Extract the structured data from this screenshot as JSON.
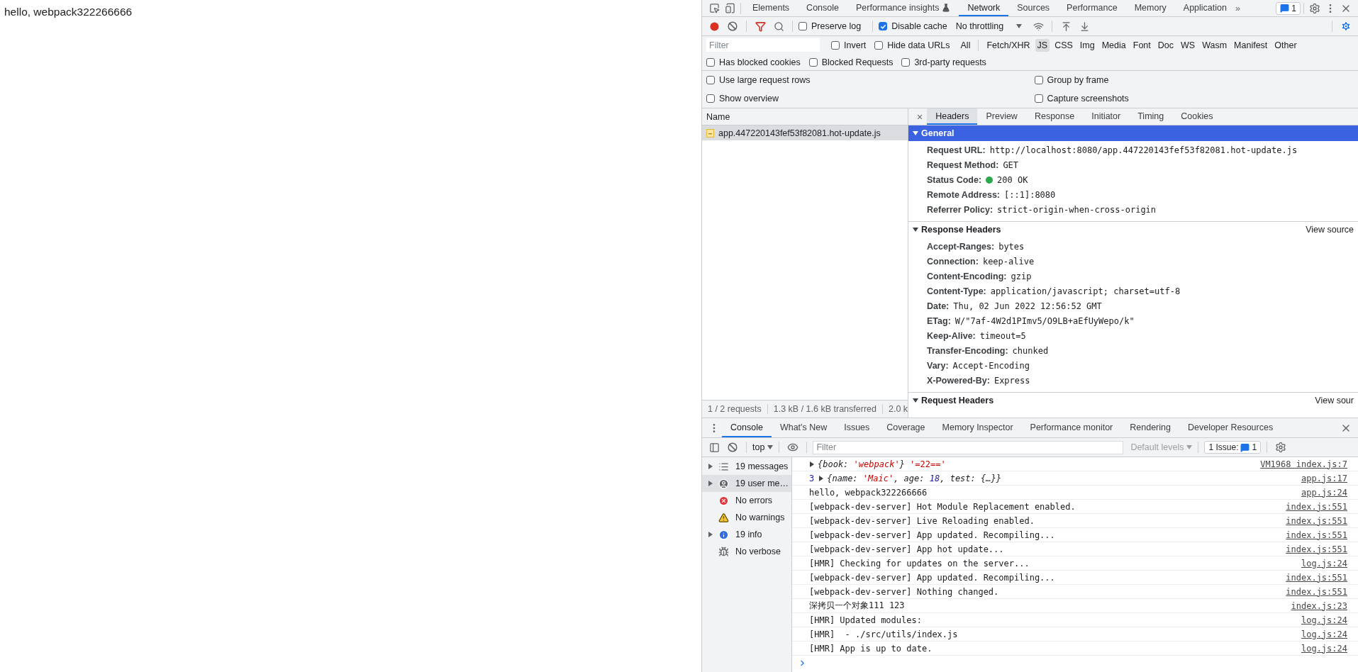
{
  "page": {
    "text": "hello, webpack322266666"
  },
  "main_tabs": [
    {
      "label": "Elements",
      "selected": false,
      "kind": "plain"
    },
    {
      "label": "Console",
      "selected": false,
      "kind": "plain"
    },
    {
      "label": "Performance insights",
      "selected": false,
      "kind": "experimental"
    },
    {
      "label": "Network",
      "selected": true,
      "kind": "plain"
    },
    {
      "label": "Sources",
      "selected": false,
      "kind": "plain"
    },
    {
      "label": "Performance",
      "selected": false,
      "kind": "plain"
    },
    {
      "label": "Memory",
      "selected": false,
      "kind": "plain"
    },
    {
      "label": "Application",
      "selected": false,
      "kind": "plain"
    }
  ],
  "more_tabs": "»",
  "issues_count": "1",
  "network_toolbar": {
    "recording": true,
    "filter_active": true,
    "checks": [
      {
        "label": "Preserve log",
        "checked": false
      },
      {
        "label": "Disable cache",
        "checked": true
      }
    ],
    "throttling": "No throttling"
  },
  "filter_row": {
    "placeholder": "Filter",
    "checks": [
      {
        "label": "Invert",
        "checked": false
      },
      {
        "label": "Hide data URLs",
        "checked": false
      }
    ],
    "types": [
      {
        "label": "All",
        "selected": false
      },
      {
        "label": "Fetch/XHR",
        "selected": false
      },
      {
        "label": "JS",
        "selected": true
      },
      {
        "label": "CSS",
        "selected": false
      },
      {
        "label": "Img",
        "selected": false
      },
      {
        "label": "Media",
        "selected": false
      },
      {
        "label": "Font",
        "selected": false
      },
      {
        "label": "Doc",
        "selected": false
      },
      {
        "label": "WS",
        "selected": false
      },
      {
        "label": "Wasm",
        "selected": false
      },
      {
        "label": "Manifest",
        "selected": false
      },
      {
        "label": "Other",
        "selected": false
      }
    ]
  },
  "blocked_row": [
    {
      "label": "Has blocked cookies",
      "checked": false
    },
    {
      "label": "Blocked Requests",
      "checked": false
    },
    {
      "label": "3rd-party requests",
      "checked": false
    }
  ],
  "settings": {
    "left": [
      {
        "label": "Use large request rows",
        "checked": false
      },
      {
        "label": "Show overview",
        "checked": false
      }
    ],
    "right": [
      {
        "label": "Group by frame",
        "checked": false
      },
      {
        "label": "Capture screenshots",
        "checked": false
      }
    ]
  },
  "requests": {
    "column": "Name",
    "rows": [
      {
        "name": "app.447220143fef53f82081.hot-update.js",
        "selected": true
      }
    ],
    "summary": [
      "1 / 2 requests",
      "1.3 kB / 1.6 kB transferred",
      "2.0 k"
    ]
  },
  "details": {
    "close": "×",
    "tabs": [
      {
        "label": "Headers",
        "selected": true
      },
      {
        "label": "Preview",
        "selected": false
      },
      {
        "label": "Response",
        "selected": false
      },
      {
        "label": "Initiator",
        "selected": false
      },
      {
        "label": "Timing",
        "selected": false
      },
      {
        "label": "Cookies",
        "selected": false
      }
    ],
    "sections": [
      {
        "title": "General",
        "expanded": true,
        "highlighted": true,
        "rows": [
          {
            "name": "Request URL:",
            "value": "http://localhost:8080/app.447220143fef53f82081.hot-update.js",
            "kind": "plain"
          },
          {
            "name": "Request Method:",
            "value": "GET",
            "kind": "plain"
          },
          {
            "name": "Status Code:",
            "value": "200 OK",
            "kind": "status"
          },
          {
            "name": "Remote Address:",
            "value": "[::1]:8080",
            "kind": "plain"
          },
          {
            "name": "Referrer Policy:",
            "value": "strict-origin-when-cross-origin",
            "kind": "plain"
          }
        ]
      },
      {
        "title": "Response Headers",
        "expanded": true,
        "highlighted": false,
        "link": "View source",
        "rows": [
          {
            "name": "Accept-Ranges:",
            "value": "bytes",
            "kind": "plain"
          },
          {
            "name": "Connection:",
            "value": "keep-alive",
            "kind": "plain"
          },
          {
            "name": "Content-Encoding:",
            "value": "gzip",
            "kind": "plain"
          },
          {
            "name": "Content-Type:",
            "value": "application/javascript; charset=utf-8",
            "kind": "plain"
          },
          {
            "name": "Date:",
            "value": "Thu, 02 Jun 2022 12:56:52 GMT",
            "kind": "plain"
          },
          {
            "name": "ETag:",
            "value": "W/\"7af-4W2d1PImv5/O9LB+aEfUyWepo/k\"",
            "kind": "plain"
          },
          {
            "name": "Keep-Alive:",
            "value": "timeout=5",
            "kind": "plain"
          },
          {
            "name": "Transfer-Encoding:",
            "value": "chunked",
            "kind": "plain"
          },
          {
            "name": "Vary:",
            "value": "Accept-Encoding",
            "kind": "plain"
          },
          {
            "name": "X-Powered-By:",
            "value": "Express",
            "kind": "plain"
          }
        ]
      },
      {
        "title": "Request Headers",
        "expanded": true,
        "highlighted": false,
        "link": "View sour"
      }
    ]
  },
  "drawer": {
    "tabs": [
      {
        "label": "Console",
        "selected": true
      },
      {
        "label": "What's New",
        "selected": false
      },
      {
        "label": "Issues",
        "selected": false
      },
      {
        "label": "Coverage",
        "selected": false
      },
      {
        "label": "Memory Inspector",
        "selected": false
      },
      {
        "label": "Performance monitor",
        "selected": false
      },
      {
        "label": "Rendering",
        "selected": false
      },
      {
        "label": "Developer Resources",
        "selected": false
      }
    ]
  },
  "console_toolbar": {
    "context": "top",
    "placeholder": "Filter",
    "levels": "Default levels",
    "levels_disabled": true,
    "issues_label": "1 Issue:",
    "issues_count": "1"
  },
  "console_sidebar": [
    {
      "label": "19 messages",
      "kind": "messages",
      "expandable": true,
      "selected": false
    },
    {
      "label": "19 user me…",
      "kind": "user",
      "expandable": true,
      "selected": true
    },
    {
      "label": "No errors",
      "kind": "error",
      "expandable": false,
      "selected": false
    },
    {
      "label": "No warnings",
      "kind": "warning",
      "expandable": false,
      "selected": false
    },
    {
      "label": "19 info",
      "kind": "info",
      "expandable": true,
      "selected": false
    },
    {
      "label": "No verbose",
      "kind": "verbose",
      "expandable": false,
      "selected": false
    }
  ],
  "messages": [
    {
      "kind": "object",
      "parts": [
        {
          "text": "{book: ",
          "kind": "object"
        },
        {
          "text": "'webpack'",
          "kind": "property_string"
        },
        {
          "text": "}",
          "kind": "object"
        },
        {
          "text": " '=22=='",
          "kind": "string"
        }
      ],
      "source": "VM1968 index.js:7"
    },
    {
      "kind": "object",
      "count": "3",
      "parts": [
        {
          "text": "{name: ",
          "kind": "object"
        },
        {
          "text": "'Maic'",
          "kind": "property_string"
        },
        {
          "text": ", age: ",
          "kind": "object"
        },
        {
          "text": "18",
          "kind": "number"
        },
        {
          "text": ", test: {…}}",
          "kind": "object"
        }
      ],
      "source": "app.js:17"
    },
    {
      "kind": "log",
      "text": "hello, webpack322266666",
      "source": "app.js:24"
    },
    {
      "kind": "log",
      "text": "[webpack-dev-server] Hot Module Replacement enabled.",
      "source": "index.js:551"
    },
    {
      "kind": "log",
      "text": "[webpack-dev-server] Live Reloading enabled.",
      "source": "index.js:551"
    },
    {
      "kind": "log",
      "text": "[webpack-dev-server] App updated. Recompiling...",
      "source": "index.js:551"
    },
    {
      "kind": "log",
      "text": "[webpack-dev-server] App hot update...",
      "source": "index.js:551"
    },
    {
      "kind": "log",
      "text": "[HMR] Checking for updates on the server...",
      "source": "log.js:24"
    },
    {
      "kind": "log",
      "text": "[webpack-dev-server] App updated. Recompiling...",
      "source": "index.js:551"
    },
    {
      "kind": "log",
      "text": "[webpack-dev-server] Nothing changed.",
      "source": "index.js:551"
    },
    {
      "kind": "log",
      "text": "深拷贝一个对象111 123",
      "source": "index.js:23"
    },
    {
      "kind": "log",
      "text": "[HMR] Updated modules:",
      "source": "log.js:24"
    },
    {
      "kind": "log",
      "text": "[HMR]  - ./src/utils/index.js",
      "source": "log.js:24"
    },
    {
      "kind": "log",
      "text": "[HMR] App is up to date.",
      "source": "log.js:24"
    }
  ]
}
